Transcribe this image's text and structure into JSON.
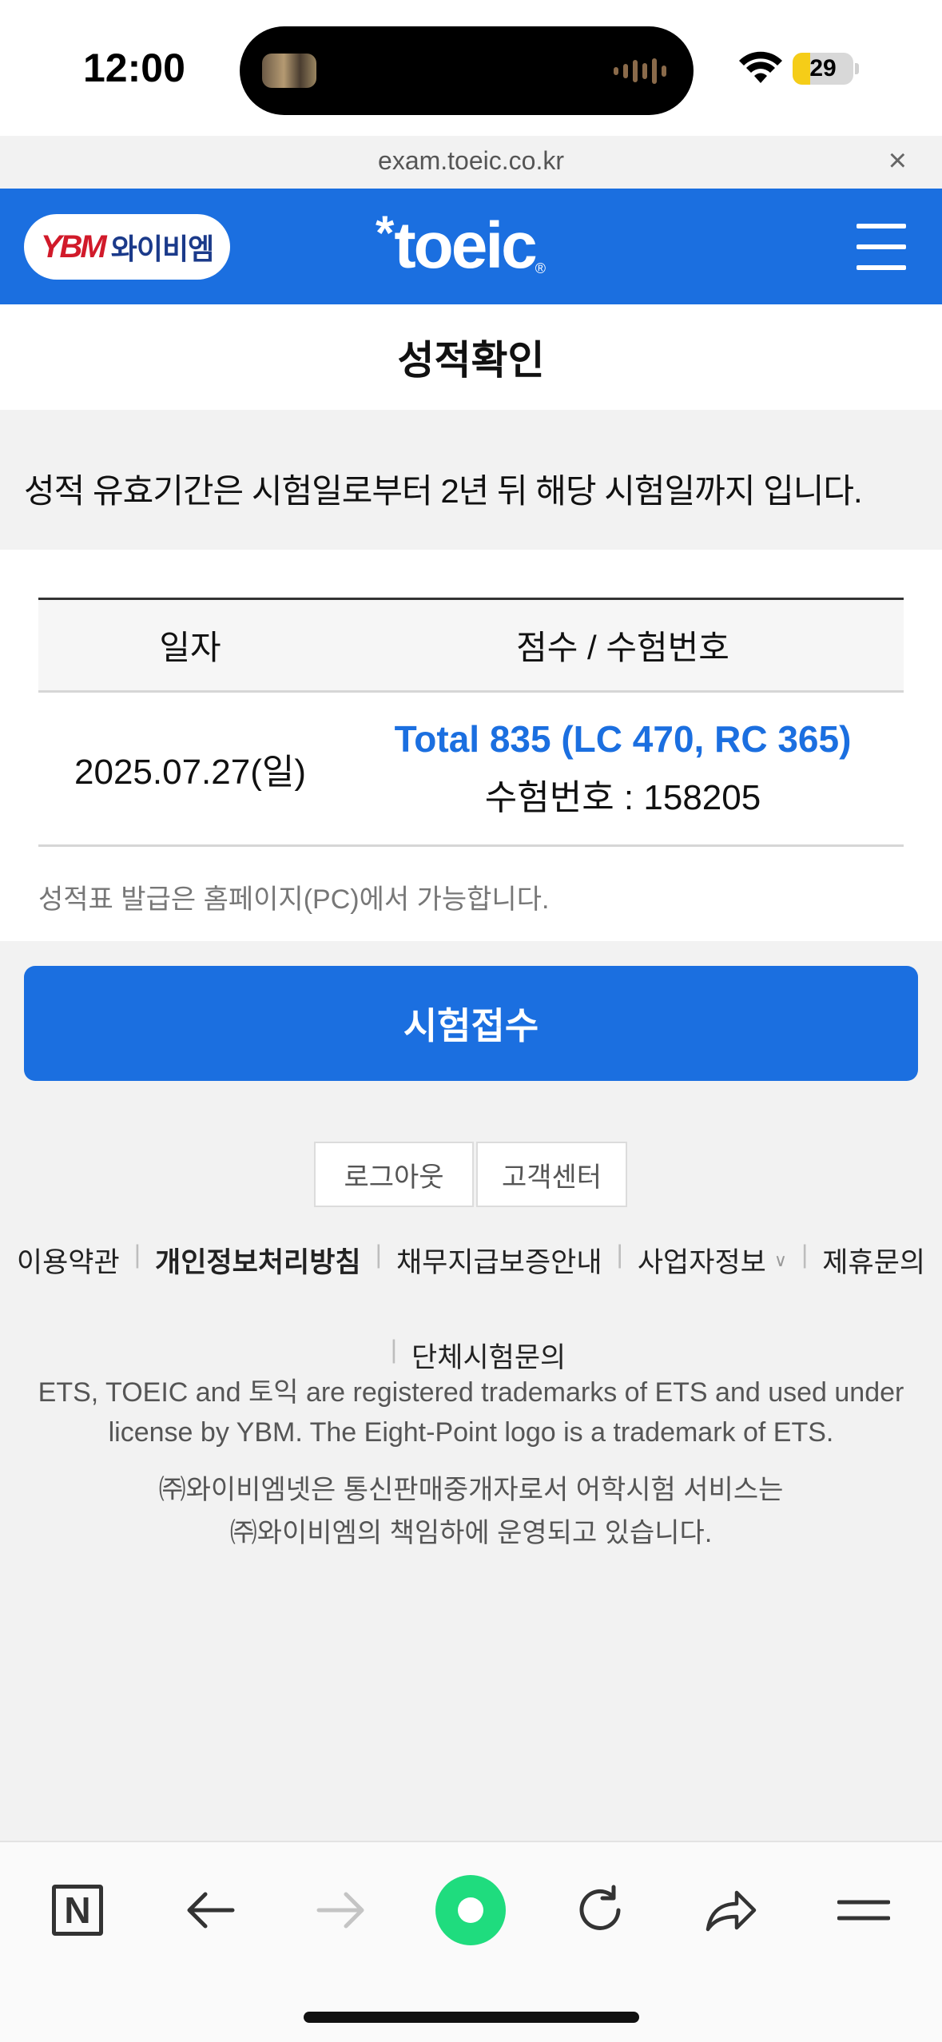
{
  "status_bar": {
    "time": "12:00",
    "battery_level": "29",
    "battery_fraction": 0.29
  },
  "browser": {
    "url": "exam.toeic.co.kr",
    "close_glyph": "×"
  },
  "header": {
    "ybm_mark": "YBM",
    "ybm_text": "와이비엠",
    "toeic_star": "*",
    "toeic_text": "toeic",
    "toeic_reg": "®"
  },
  "page": {
    "title": "성적확인",
    "notice": "성적 유효기간은 시험일로부터 2년 뒤 해당 시험일까지 입니다."
  },
  "score_table": {
    "headers": [
      "일자",
      "점수 / 수험번호"
    ],
    "rows": [
      {
        "date": "2025.07.27(일)",
        "total": "Total 835 (LC 470, RC 365)",
        "exam_no": "수험번호 : 158205"
      }
    ],
    "note": "성적표 발급은 홈페이지(PC)에서 가능합니다."
  },
  "apply_button": "시험접수",
  "footer": {
    "logout": "로그아웃",
    "customer_center": "고객센터",
    "links": {
      "terms": "이용약관",
      "privacy": "개인정보처리방침",
      "guarantee": "채무지급보증안내",
      "business_info": "사업자정보",
      "partnership": "제휴문의",
      "group_exam": "단체시험문의"
    },
    "trademark": "ETS, TOEIC and 토익 are registered trademarks of ETS and used under license by YBM. The Eight-Point logo is a trademark of ETS.",
    "company_line1": "㈜와이비엠넷은 통신판매중개자로서 어학시험 서비스는",
    "company_line2": "㈜와이비엠의 책임하에 운영되고 있습니다."
  },
  "toolbar": {
    "naver_label": "N"
  },
  "colors": {
    "brand_blue": "#1b6fe0",
    "naver_green": "#1fdc7e",
    "battery_yellow": "#f5cd18"
  }
}
